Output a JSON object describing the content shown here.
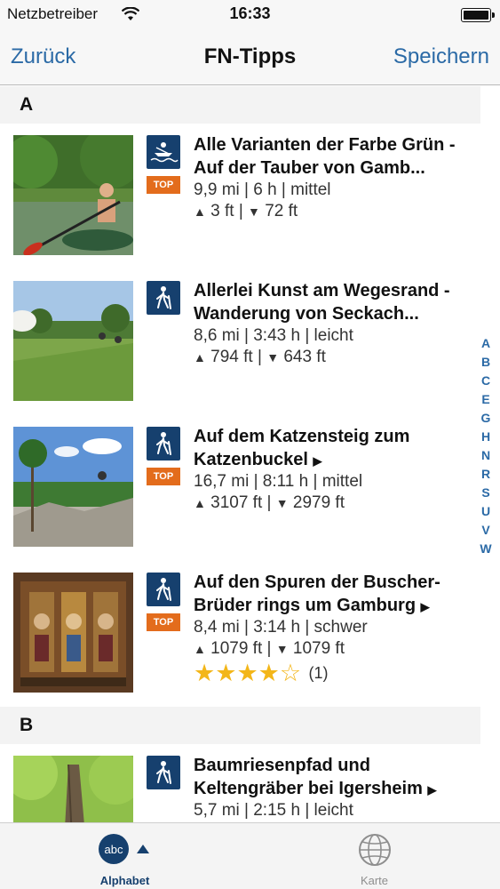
{
  "status_bar": {
    "carrier": "Netzbetreiber",
    "time": "16:33"
  },
  "nav": {
    "back_label": "Zurück",
    "title": "FN-Tipps",
    "save_label": "Speichern"
  },
  "sections": [
    {
      "letter": "A",
      "tours": [
        {
          "title": "Alle Varianten der Farbe Grün - Auf der Tauber von Gamb...",
          "activity_icon": "canoe-icon",
          "top": "TOP",
          "stats": "9,9 mi | 6 h | mittel",
          "ascent": "3 ft",
          "descent": "72 ft"
        },
        {
          "title": "Allerlei Kunst am Wegesrand - Wanderung von Seckach...",
          "activity_icon": "hiking-icon",
          "stats": "8,6 mi | 3:43 h | leicht",
          "ascent": "794 ft",
          "descent": "643 ft"
        },
        {
          "title": "Auf dem Katzensteig zum Katzenbuckel",
          "activity_icon": "hiking-icon",
          "top": "TOP",
          "stats": "16,7 mi | 8:11 h | mittel",
          "ascent": "3107 ft",
          "descent": "2979 ft"
        },
        {
          "title": "Auf den Spuren der Buscher-Brüder rings um Gamburg",
          "activity_icon": "hiking-icon",
          "top": "TOP",
          "stats": "8,4 mi | 3:14 h | schwer",
          "ascent": "1079 ft",
          "descent": "1079 ft",
          "rating_stars": 4,
          "rating_max": 5,
          "rating_count": "(1)"
        }
      ]
    },
    {
      "letter": "B",
      "tours": [
        {
          "title": "Baumriesenpfad und Keltengräber bei Igersheim",
          "activity_icon": "hiking-icon",
          "stats": "5,7 mi | 2:15 h | leicht"
        }
      ]
    }
  ],
  "alphabet_index": [
    "A",
    "B",
    "C",
    "E",
    "G",
    "H",
    "N",
    "R",
    "S",
    "U",
    "V",
    "W"
  ],
  "tabs": [
    {
      "label": "Alphabet",
      "icon": "abc-icon",
      "active": true
    },
    {
      "label": "Karte",
      "icon": "globe-icon",
      "active": false
    }
  ],
  "colors": {
    "accent_blue": "#2b6aa6",
    "badge_orange": "#e36c1c",
    "icon_navy": "#16406e",
    "star_gold": "#f3b619"
  }
}
